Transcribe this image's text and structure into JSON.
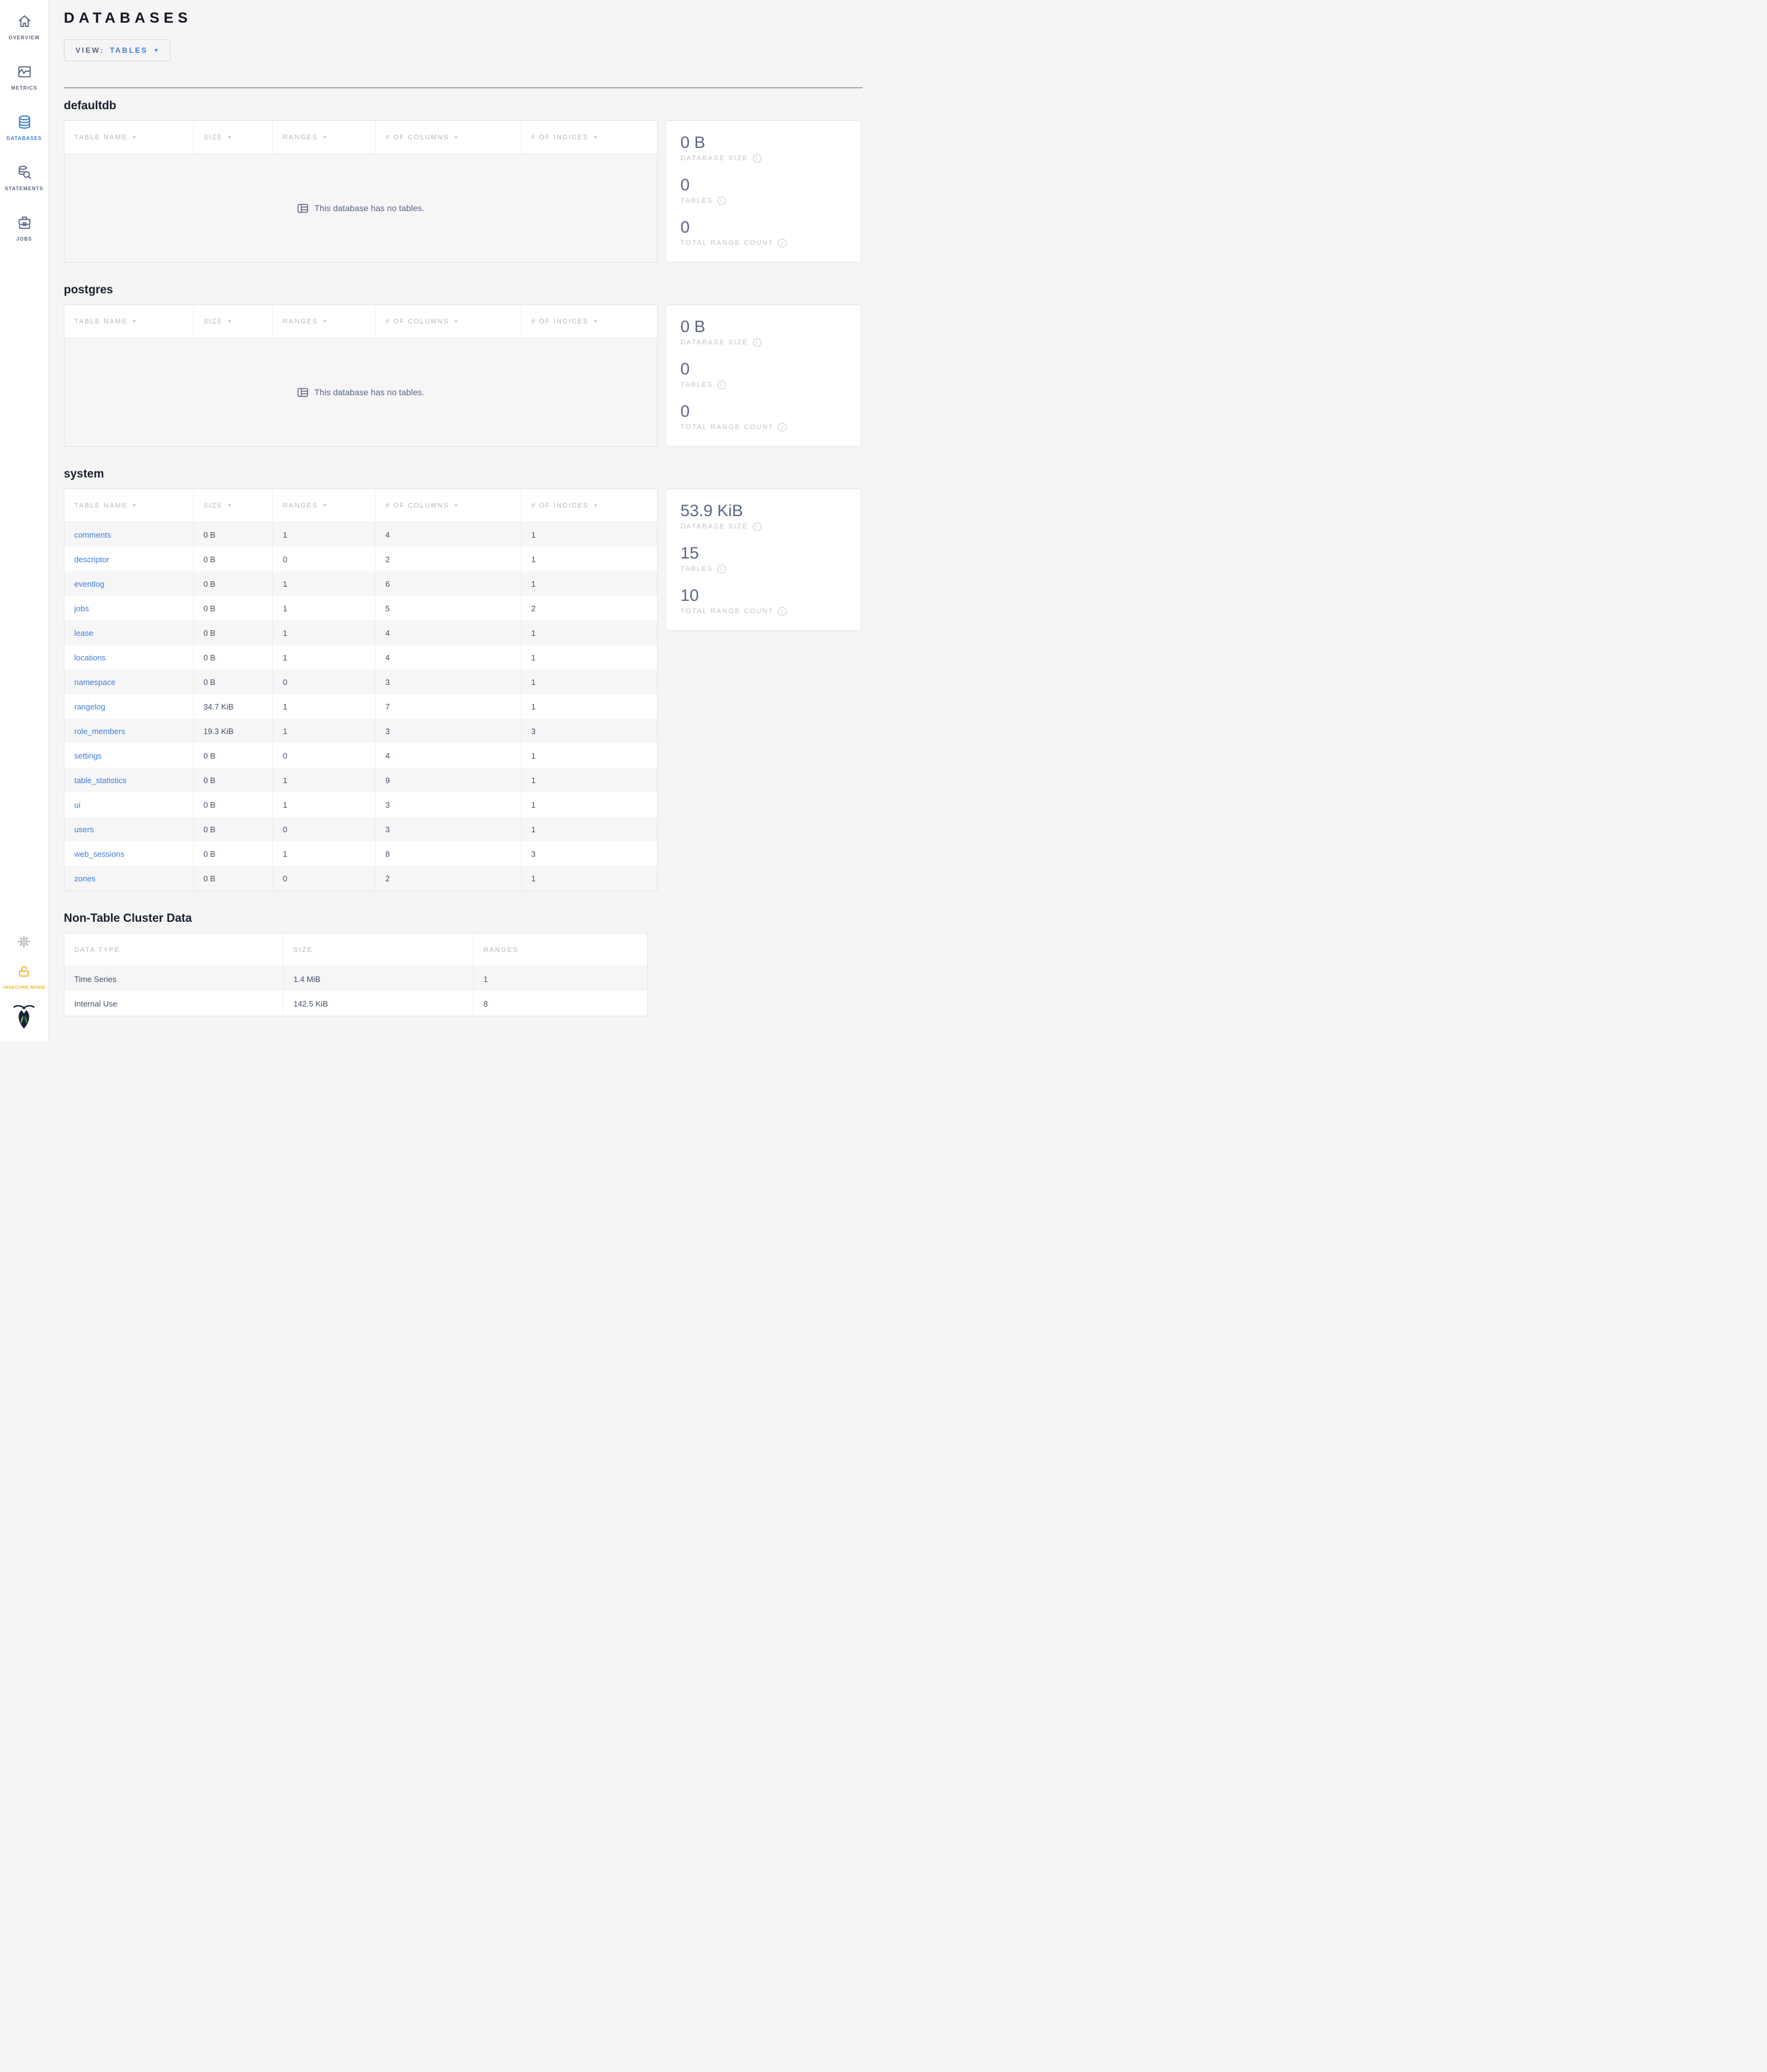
{
  "app": {
    "title": "DATABASES"
  },
  "view_selector": {
    "label": "VIEW:",
    "value": "TABLES"
  },
  "glyphs": {
    "sort_arrow": "▼",
    "caret": "▼",
    "info": "i"
  },
  "colors": {
    "accent_blue": "#3b7dd8",
    "insecure_yellow": "#eab725",
    "slate": "#5a6782"
  },
  "sidebar": {
    "items": [
      {
        "label": "OVERVIEW"
      },
      {
        "label": "METRICS"
      },
      {
        "label": "DATABASES",
        "active": true
      },
      {
        "label": "STATEMENTS"
      },
      {
        "label": "JOBS"
      }
    ],
    "insecure_label": "INSECURE MODE"
  },
  "table_columns": [
    "TABLE NAME",
    "SIZE",
    "RANGES",
    "# OF COLUMNS",
    "# OF INDICES"
  ],
  "empty_message": "This database has no tables.",
  "sections": [
    {
      "name": "defaultdb",
      "empty": true,
      "stats": [
        {
          "value": "0 B",
          "label": "DATABASE SIZE"
        },
        {
          "value": "0",
          "label": "TABLES"
        },
        {
          "value": "0",
          "label": "TOTAL RANGE COUNT"
        }
      ]
    },
    {
      "name": "postgres",
      "empty": true,
      "stats": [
        {
          "value": "0 B",
          "label": "DATABASE SIZE"
        },
        {
          "value": "0",
          "label": "TABLES"
        },
        {
          "value": "0",
          "label": "TOTAL RANGE COUNT"
        }
      ]
    },
    {
      "name": "system",
      "empty": false,
      "rows": [
        {
          "name": "comments",
          "size": "0 B",
          "ranges": "1",
          "columns": "4",
          "indices": "1"
        },
        {
          "name": "descriptor",
          "size": "0 B",
          "ranges": "0",
          "columns": "2",
          "indices": "1"
        },
        {
          "name": "eventlog",
          "size": "0 B",
          "ranges": "1",
          "columns": "6",
          "indices": "1"
        },
        {
          "name": "jobs",
          "size": "0 B",
          "ranges": "1",
          "columns": "5",
          "indices": "2"
        },
        {
          "name": "lease",
          "size": "0 B",
          "ranges": "1",
          "columns": "4",
          "indices": "1"
        },
        {
          "name": "locations",
          "size": "0 B",
          "ranges": "1",
          "columns": "4",
          "indices": "1"
        },
        {
          "name": "namespace",
          "size": "0 B",
          "ranges": "0",
          "columns": "3",
          "indices": "1"
        },
        {
          "name": "rangelog",
          "size": "34.7 KiB",
          "ranges": "1",
          "columns": "7",
          "indices": "1"
        },
        {
          "name": "role_members",
          "size": "19.3 KiB",
          "ranges": "1",
          "columns": "3",
          "indices": "3"
        },
        {
          "name": "settings",
          "size": "0 B",
          "ranges": "0",
          "columns": "4",
          "indices": "1"
        },
        {
          "name": "table_statistics",
          "size": "0 B",
          "ranges": "1",
          "columns": "9",
          "indices": "1"
        },
        {
          "name": "ui",
          "size": "0 B",
          "ranges": "1",
          "columns": "3",
          "indices": "1"
        },
        {
          "name": "users",
          "size": "0 B",
          "ranges": "0",
          "columns": "3",
          "indices": "1"
        },
        {
          "name": "web_sessions",
          "size": "0 B",
          "ranges": "1",
          "columns": "8",
          "indices": "3"
        },
        {
          "name": "zones",
          "size": "0 B",
          "ranges": "0",
          "columns": "2",
          "indices": "1"
        }
      ],
      "stats": [
        {
          "value": "53.9 KiB",
          "label": "DATABASE SIZE"
        },
        {
          "value": "15",
          "label": "TABLES"
        },
        {
          "value": "10",
          "label": "TOTAL RANGE COUNT"
        }
      ]
    }
  ],
  "non_table": {
    "title": "Non-Table Cluster Data",
    "columns": [
      "DATA TYPE",
      "SIZE",
      "RANGES"
    ],
    "rows": [
      {
        "type": "Time Series",
        "size": "1.4 MiB",
        "ranges": "1"
      },
      {
        "type": "Internal Use",
        "size": "142.5 KiB",
        "ranges": "8"
      }
    ]
  }
}
